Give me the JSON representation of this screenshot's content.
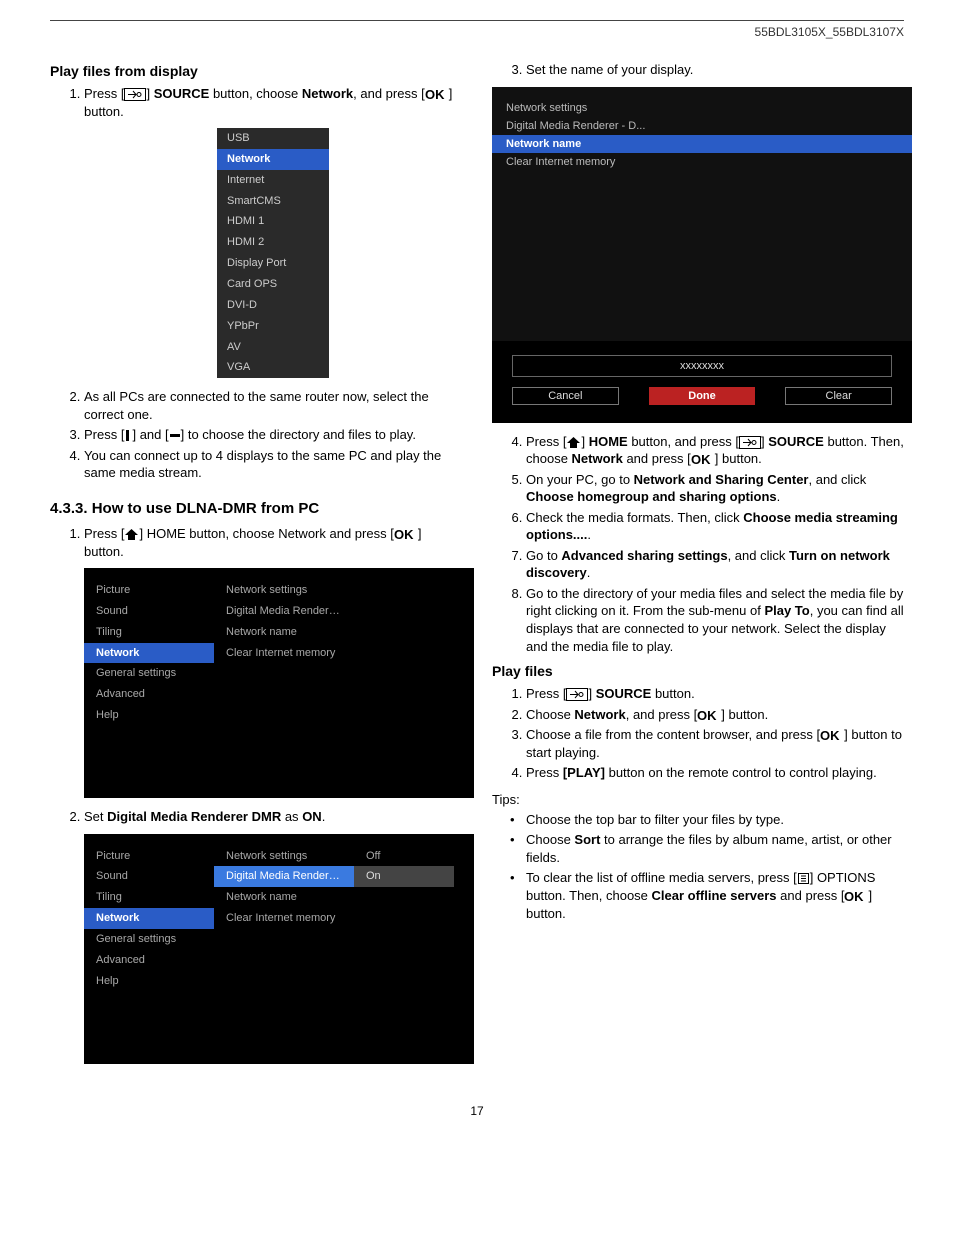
{
  "header": {
    "model": "55BDL3105X_55BDL3107X"
  },
  "left": {
    "h_playfiles": "Play files from display",
    "step1_a": "Press [",
    "step1_b": "] ",
    "step1_src": "SOURCE",
    "step1_c": " button, choose ",
    "step1_net": "Network",
    "step1_d": ", and press [",
    "step1_e": "] button.",
    "source_items": [
      "USB",
      "Network",
      "Internet",
      "SmartCMS",
      "HDMI 1",
      "HDMI 2",
      "Display Port",
      "Card OPS",
      "DVI-D",
      "YPbPr",
      "AV",
      "VGA"
    ],
    "step2": "As all PCs are connected to the same router now, select the correct one.",
    "step3_a": "Press [",
    "step3_b": "] and [",
    "step3_c": "] to choose the directory and files to play.",
    "step4": "You can connect up to 4 displays to the same PC and play the same media stream.",
    "h_dlna": "4.3.3.  How to use DLNA-DMR from PC",
    "dlna1_a": "Press [",
    "dlna1_b": "]  HOME button, choose Network and press [",
    "dlna1_c": "] button.",
    "panel_left": [
      "Picture",
      "Sound",
      "Tiling",
      "Network",
      "General settings",
      "Advanced",
      "Help"
    ],
    "panel_mid1": [
      "Network settings",
      "Digital Media Rendere...",
      "Network name",
      "Clear Internet memory"
    ],
    "dlna2_a": "Set ",
    "dlna2_b": "Digital Media Renderer DMR",
    "dlna2_c": " as ",
    "dlna2_d": "ON",
    "dlna2_e": ".",
    "panel_right2": [
      "Off",
      "On"
    ]
  },
  "right": {
    "step3": "Set the name of your display.",
    "net_top": [
      "Network settings",
      "Digital Media Renderer - D...",
      "Network name",
      "Clear Internet memory"
    ],
    "kb_display": "xxxxxxxx",
    "kb_cancel": "Cancel",
    "kb_done": "Done",
    "kb_clear": "Clear",
    "step4_a": "Press  [",
    "step4_b": "] ",
    "step4_home": "HOME",
    "step4_c": " button, and press [",
    "step4_d": "] ",
    "step4_src": "SOURCE",
    "step4_e": " button. Then, choose ",
    "step4_net": "Network",
    "step4_f": " and press [",
    "step4_g": "] button.",
    "step5_a": "On your PC, go to ",
    "step5_b": "Network and Sharing Center",
    "step5_c": ", and click ",
    "step5_d": "Choose homegroup and sharing options",
    "step5_e": ".",
    "step6_a": "Check the media formats. Then, click ",
    "step6_b": "Choose media streaming options....",
    "step6_c": ".",
    "step7_a": "Go to ",
    "step7_b": "Advanced sharing settings",
    "step7_c": ", and click ",
    "step7_d": "Turn on network discovery",
    "step7_e": ".",
    "step8_a": "Go to the directory of your media files and select the media file by right clicking on it. From the sub-menu of ",
    "step8_b": "Play To",
    "step8_c": ", you can find all displays that are connected to your network. Select the display and the media file to play.",
    "h_playfiles2": "Play files",
    "pf1_a": "Press [",
    "pf1_b": "] ",
    "pf1_src": "SOURCE",
    "pf1_c": " button.",
    "pf2_a": "Choose ",
    "pf2_b": "Network",
    "pf2_c": ", and press [",
    "pf2_d": "] button.",
    "pf3_a": "Choose a file from the content browser, and press [",
    "pf3_b": "] button to start playing.",
    "pf4_a": "Press ",
    "pf4_b": "[PLAY]",
    "pf4_c": " button on the remote control to control playing.",
    "tips": "Tips:",
    "tip1": "Choose the top bar to filter your files by type.",
    "tip2_a": "Choose ",
    "tip2_b": "Sort",
    "tip2_c": " to arrange the files by album name, artist, or other fields.",
    "tip3_a": "To clear the list of offline media servers, press [",
    "tip3_b": "] OPTIONS button. Then, choose ",
    "tip3_c": "Clear offline servers",
    "tip3_d": " and press [",
    "tip3_e": "] button."
  },
  "pagenum": "17"
}
